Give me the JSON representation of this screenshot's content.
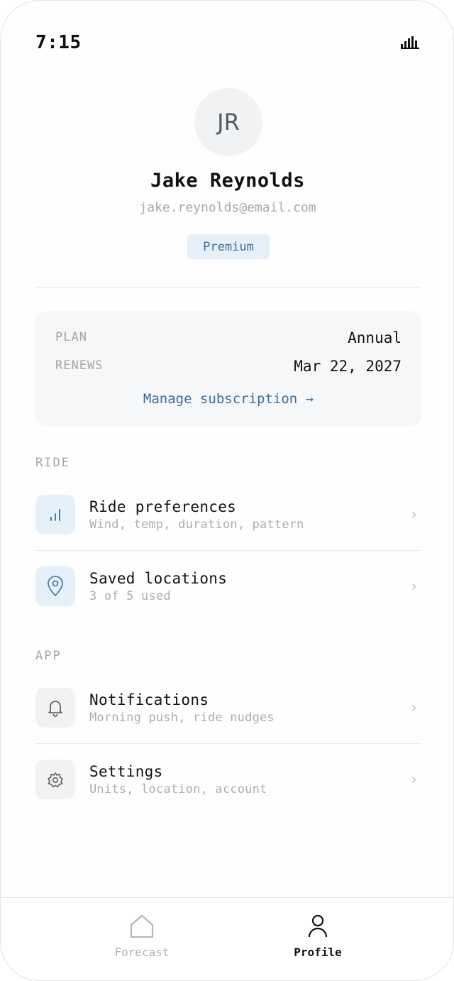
{
  "status_bar": {
    "time": "7:15",
    "signal_icon": "signal-bars-icon"
  },
  "profile": {
    "initials": "JR",
    "name": "Jake Reynolds",
    "email": "jake.reynolds@email.com",
    "badge": "Premium"
  },
  "subscription": {
    "plan_label": "PLAN",
    "plan_value": "Annual",
    "renews_label": "RENEWS",
    "renews_value": "Mar 22, 2027",
    "manage_link": "Manage subscription →"
  },
  "sections": {
    "ride": {
      "heading": "RIDE",
      "items": [
        {
          "title": "Ride preferences",
          "subtitle": "Wind, temp, duration, pattern",
          "icon": "bar-chart-icon"
        },
        {
          "title": "Saved locations",
          "subtitle": "3 of 5 used",
          "icon": "map-pin-icon"
        }
      ]
    },
    "app": {
      "heading": "APP",
      "items": [
        {
          "title": "Notifications",
          "subtitle": "Morning push, ride nudges",
          "icon": "bell-icon"
        },
        {
          "title": "Settings",
          "subtitle": "Units, location, account",
          "icon": "gear-icon"
        }
      ]
    }
  },
  "chevron": "›",
  "tab_bar": {
    "tabs": [
      {
        "label": "Forecast",
        "icon": "home-icon",
        "active": false
      },
      {
        "label": "Profile",
        "icon": "person-icon",
        "active": true
      }
    ]
  },
  "colors": {
    "accent": "#3e6e98",
    "accent_bg": "#e6f0f9",
    "muted_text": "#a9a9a9",
    "card_bg": "#f5f7f9"
  }
}
